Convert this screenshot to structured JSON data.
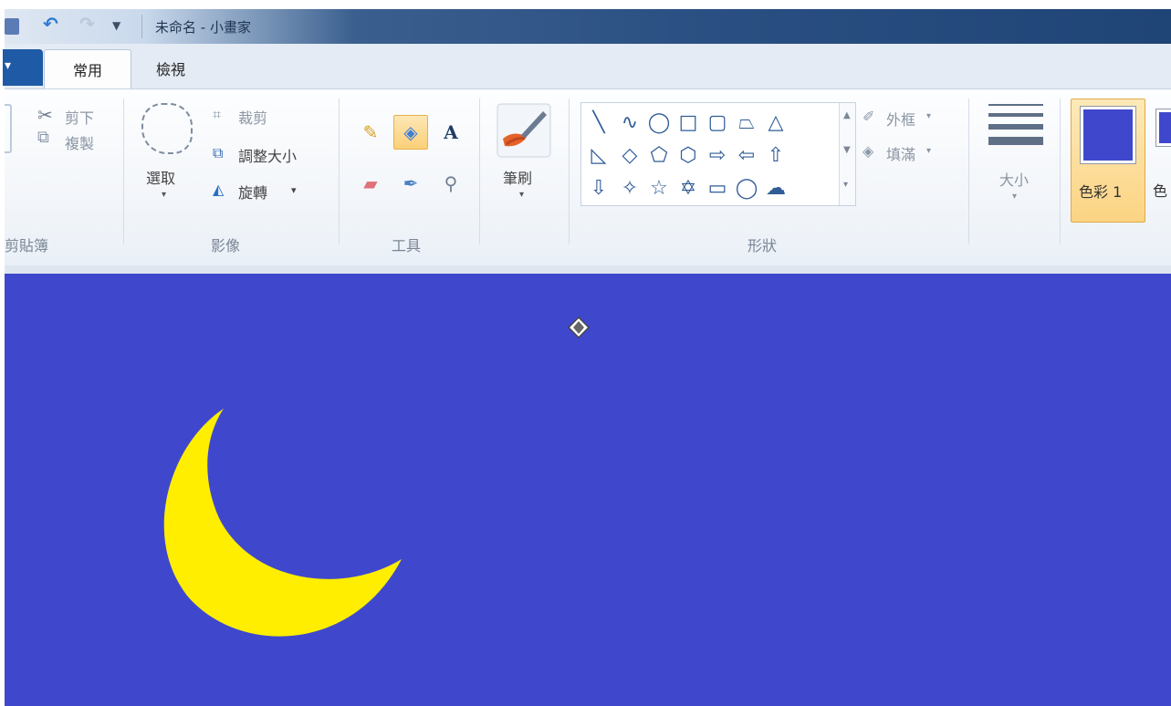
{
  "window": {
    "title": "未命名 - 小畫家"
  },
  "quick_access": {
    "icons": [
      "save-icon",
      "undo-icon",
      "redo-icon",
      "chevron-down-icon"
    ]
  },
  "tabs": [
    {
      "label": "常用",
      "selected": true
    },
    {
      "label": "檢視",
      "selected": false
    }
  ],
  "ribbon": {
    "clipboard": {
      "label": "剪貼簿",
      "cut": "剪下",
      "copy": "複製"
    },
    "image": {
      "label": "影像",
      "select": "選取",
      "crop": "裁剪",
      "resize": "調整大小",
      "rotate": "旋轉"
    },
    "tools": {
      "label": "工具",
      "active_tool": "fill"
    },
    "brushes": {
      "label": "筆刷"
    },
    "shapes": {
      "label": "形狀",
      "outline": "外框",
      "fill": "填滿"
    },
    "size": {
      "label": "大小"
    },
    "colors": {
      "color1_label": "色彩 1",
      "color2_label": "色",
      "color1": "#3f48cc",
      "color2": "#3f48cc"
    }
  },
  "canvas": {
    "background": "#3f48cc",
    "moon_color": "#ffee00"
  }
}
